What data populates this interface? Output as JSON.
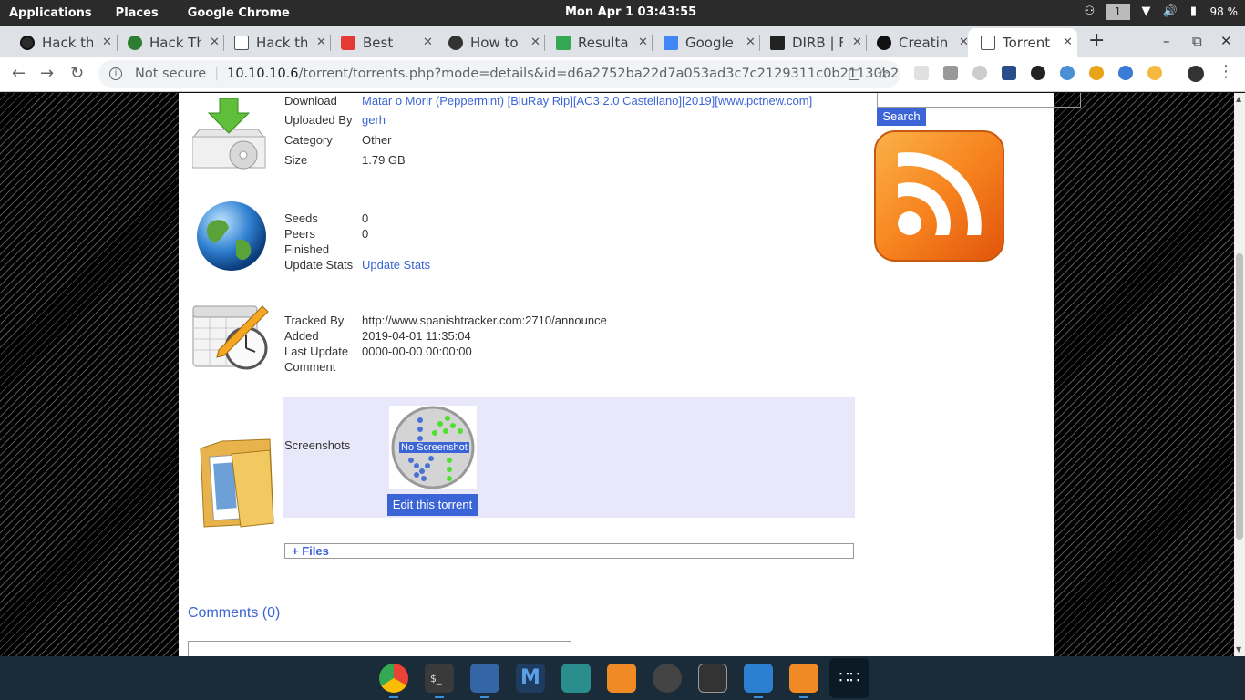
{
  "system_bar": {
    "applications": "Applications",
    "places": "Places",
    "app_name": "Google Chrome",
    "clock": "Mon Apr 1  03:43:55",
    "workspace": "1",
    "battery": "98 %"
  },
  "tabs": [
    {
      "title": "Hack the",
      "favicon_color": "#2b2b2b"
    },
    {
      "title": "Hack Th",
      "favicon_color": "#2e7d32"
    },
    {
      "title": "Hack the",
      "favicon_color": "#ffffff"
    },
    {
      "title": "Best",
      "favicon_color": "#e53935"
    },
    {
      "title": "How to",
      "favicon_color": "#333333"
    },
    {
      "title": "Resulta",
      "favicon_color": "#34a853"
    },
    {
      "title": "Google",
      "favicon_color": "#4285f4"
    },
    {
      "title": "DIRB | F",
      "favicon_color": "#222222"
    },
    {
      "title": "Creatin",
      "favicon_color": "#111111"
    },
    {
      "title": "Torrent",
      "favicon_color": "#ffffff"
    }
  ],
  "toolbar": {
    "security": "Not secure",
    "url_host": "10.10.10.6",
    "url_path": "/torrent/torrents.php?mode=details&id=d6a2752ba22d7a053ad3c7c2129311c0b21130b2"
  },
  "details": {
    "download_label": "Download",
    "download_value": "Matar o Morir (Peppermint) [BluRay Rip][AC3 2.0 Castellano][2019][www.pctnew.com]",
    "uploaded_by_label": "Uploaded By",
    "uploaded_by_value": "gerh",
    "category_label": "Category",
    "category_value": "Other",
    "size_label": "Size",
    "size_value": "1.79 GB",
    "seeds_label": "Seeds",
    "seeds_value": "0",
    "peers_label": "Peers",
    "peers_value": "0",
    "finished_label": "Finished",
    "update_stats_label": "Update Stats",
    "update_stats_link": "Update Stats",
    "tracked_by_label": "Tracked By",
    "tracked_by_value": "http://www.spanishtracker.com:2710/announce",
    "added_label": "Added",
    "added_value": "2019-04-01 11:35:04",
    "last_update_label": "Last Update",
    "last_update_value": "0000-00-00 00:00:00",
    "comment_label": "Comment",
    "screenshots_label": "Screenshots",
    "no_screenshot": "No Screenshot",
    "edit_button": "Edit this torrent",
    "files_toggle": "+ Files",
    "comments_link": "Comments (0)"
  },
  "sidebar": {
    "search_button": "Search"
  }
}
